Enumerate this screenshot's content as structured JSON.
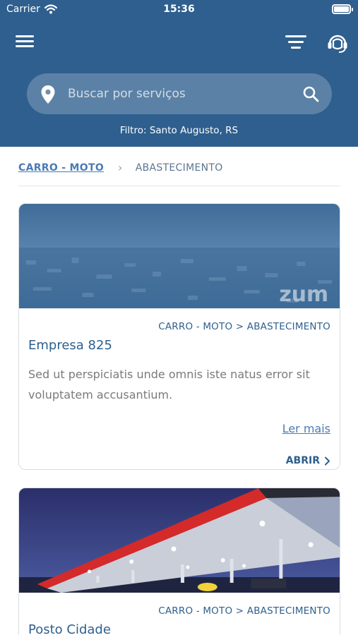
{
  "status_bar": {
    "carrier": "Carrier",
    "time": "15:36"
  },
  "search": {
    "placeholder": "Buscar por serviços",
    "value": ""
  },
  "filter": {
    "text": "Filtro: Santo Augusto, RS"
  },
  "breadcrumb": {
    "parent": "CARRO - MOTO",
    "current": "ABASTECIMENTO"
  },
  "cards": [
    {
      "category": "CARRO - MOTO > ABASTECIMENTO",
      "title": "Empresa 825",
      "description": "Sed ut perspiciatis unde omnis iste natus error sit voluptatem accusantium.",
      "read_more": "Ler mais",
      "open_label": "ABRIR",
      "image_watermark": "zum"
    },
    {
      "category": "CARRO - MOTO > ABASTECIMENTO",
      "title": "Posto Cidade"
    }
  ],
  "colors": {
    "header": "#2e5f8e",
    "accent": "#4a7bb5",
    "canopy_red": "#d42a2a"
  },
  "icons": [
    "wifi-icon",
    "battery-icon",
    "menu-icon",
    "filter-icon",
    "support-icon",
    "location-pin-icon",
    "search-icon",
    "chevron-right-icon"
  ]
}
